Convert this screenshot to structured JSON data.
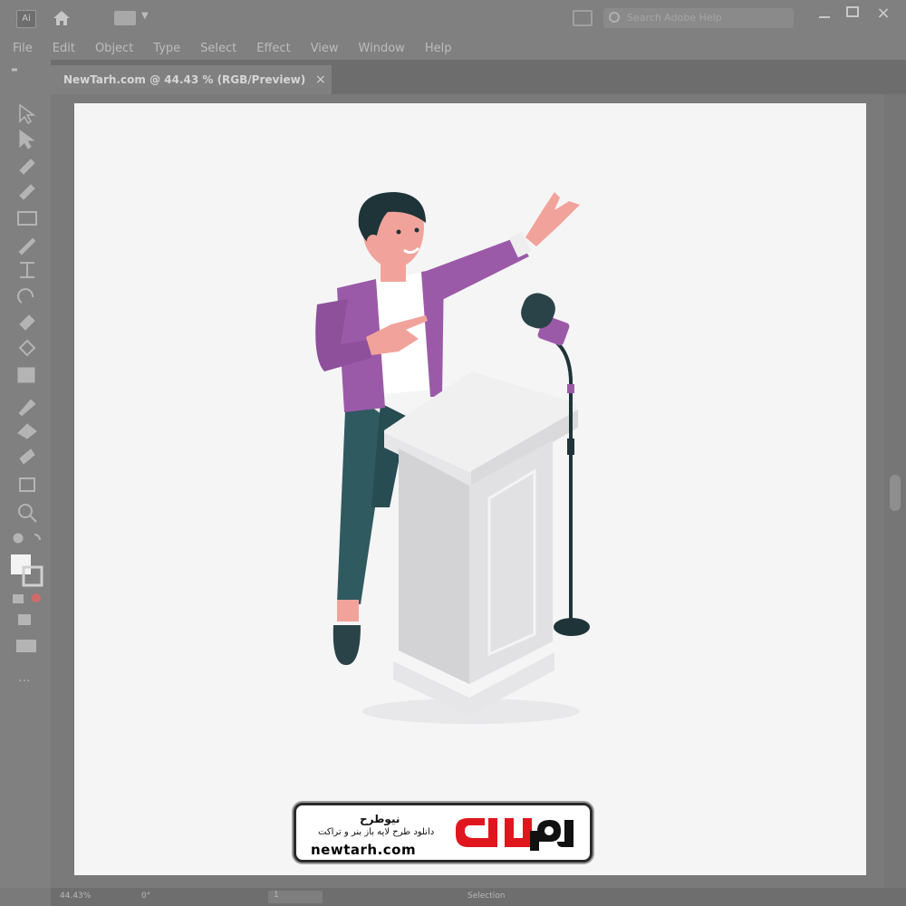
{
  "app": {
    "logo_text": "Ai",
    "search_placeholder": "Search Adobe Help"
  },
  "menu": [
    "File",
    "Edit",
    "Object",
    "Type",
    "Select",
    "Effect",
    "View",
    "Window",
    "Help"
  ],
  "document_tab": {
    "label": "NewTarh.com @ 44.43 % (RGB/Preview)",
    "close": "×"
  },
  "status": {
    "zoom": "44.43%",
    "rotate": "0°",
    "artboard": "1",
    "selection": "Selection"
  },
  "watermark": {
    "title": "نیوطرح",
    "subtitle": "دانلود طرح لایه باز بنر و تراکت",
    "url": "newtarh.com"
  },
  "colors": {
    "accent_red": "#e0161f",
    "jacket_purple": "#9b5aa8",
    "pants_teal": "#2f5a60",
    "skin": "#f1a39b",
    "podium": "#e2e2e2"
  },
  "icons": [
    "home-icon",
    "search-icon",
    "arrange-documents-icon",
    "minimize-icon",
    "maximize-icon",
    "close-icon"
  ]
}
